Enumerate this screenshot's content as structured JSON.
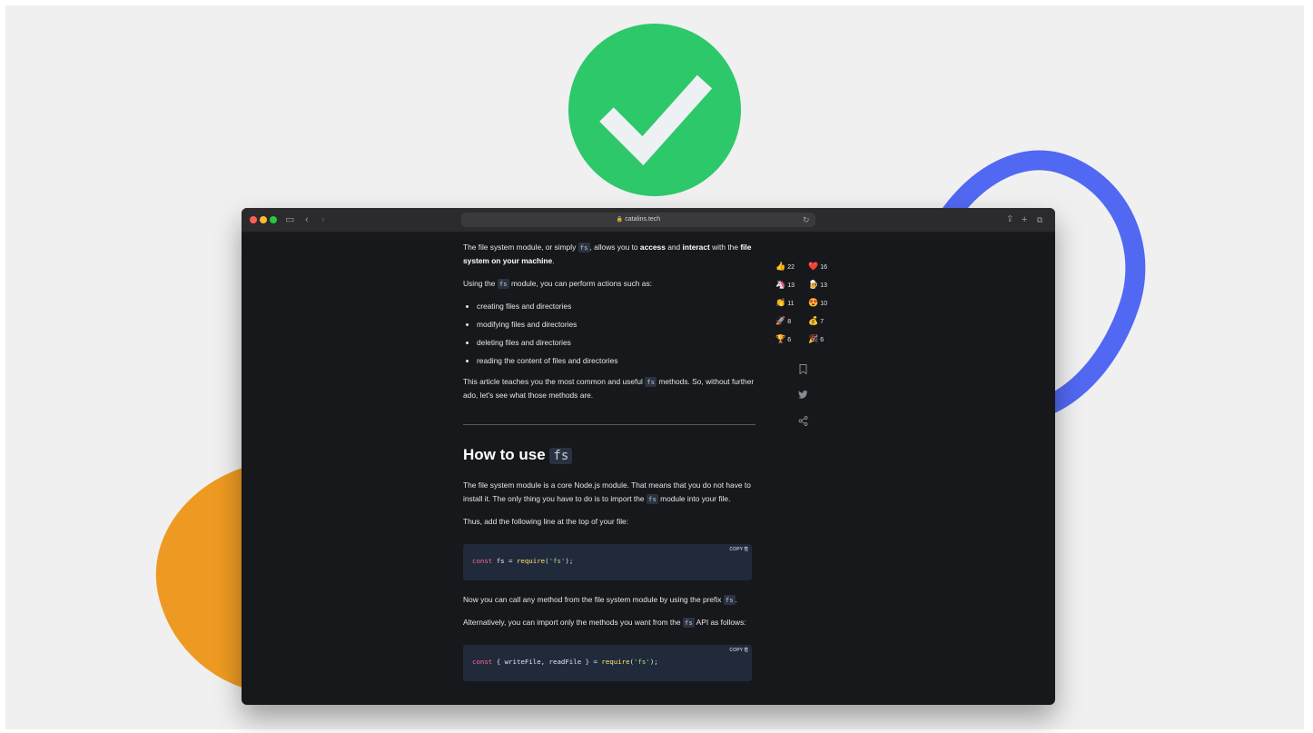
{
  "browser": {
    "url": "catalins.tech"
  },
  "article": {
    "intro_1_pre": "The file system module, or simply ",
    "intro_1_code": "fs",
    "intro_1_mid": ", allows you to ",
    "intro_1_b1": "access",
    "intro_1_and": " and ",
    "intro_1_b2": "interact",
    "intro_1_post": " with the ",
    "intro_1_b3": "file system on your machine",
    "intro_1_end": ".",
    "intro_2_pre": "Using the ",
    "intro_2_code": "fs",
    "intro_2_post": " module, you can perform actions such as:",
    "list": [
      "creating files and directories",
      "modifying files and directories",
      "deleting files and directories",
      "reading the content of files and directories"
    ],
    "intro_3_pre": "This article teaches you the most common and useful ",
    "intro_3_code": "fs",
    "intro_3_post": " methods. So, without further ado, let's see what those methods are.",
    "heading_text": "How to use ",
    "heading_code": "fs",
    "body_1_pre": "The file system module is a core Node.js module. That means that you do not have to install it. The only thing you have to do is to import the ",
    "body_1_code": "fs",
    "body_1_post": " module into your file.",
    "body_2": "Thus, add the following line at the top of your file:",
    "code_1": {
      "copy_label": "COPY",
      "kw": "const",
      "var": " fs = ",
      "fn": "require",
      "open": "(",
      "str": "'fs'",
      "close": ");"
    },
    "body_3_pre": "Now you can call any method from the file system module by using the prefix ",
    "body_3_code": "fs",
    "body_3_post": ".",
    "body_4_pre": "Alternatively, you can import only the methods you want from the ",
    "body_4_code": "fs",
    "body_4_post": " API as follows:",
    "code_2": {
      "copy_label": "COPY",
      "kw": "const",
      "var": " { writeFile, readFile } = ",
      "fn": "require",
      "open": "(",
      "str": "'fs'",
      "close": ");"
    }
  },
  "reactions": [
    {
      "emoji": "👍",
      "count": "22"
    },
    {
      "emoji": "❤️",
      "count": "16"
    },
    {
      "emoji": "🦄",
      "count": "13"
    },
    {
      "emoji": "🍺",
      "count": "13"
    },
    {
      "emoji": "👏",
      "count": "11"
    },
    {
      "emoji": "😍",
      "count": "10"
    },
    {
      "emoji": "🚀",
      "count": "8"
    },
    {
      "emoji": "💰",
      "count": "7"
    },
    {
      "emoji": "🏆",
      "count": "6"
    },
    {
      "emoji": "🎉",
      "count": "6"
    }
  ],
  "icons": {
    "bookmark": "🔖",
    "twitter": "twitter-icon",
    "share": "share-icon"
  }
}
